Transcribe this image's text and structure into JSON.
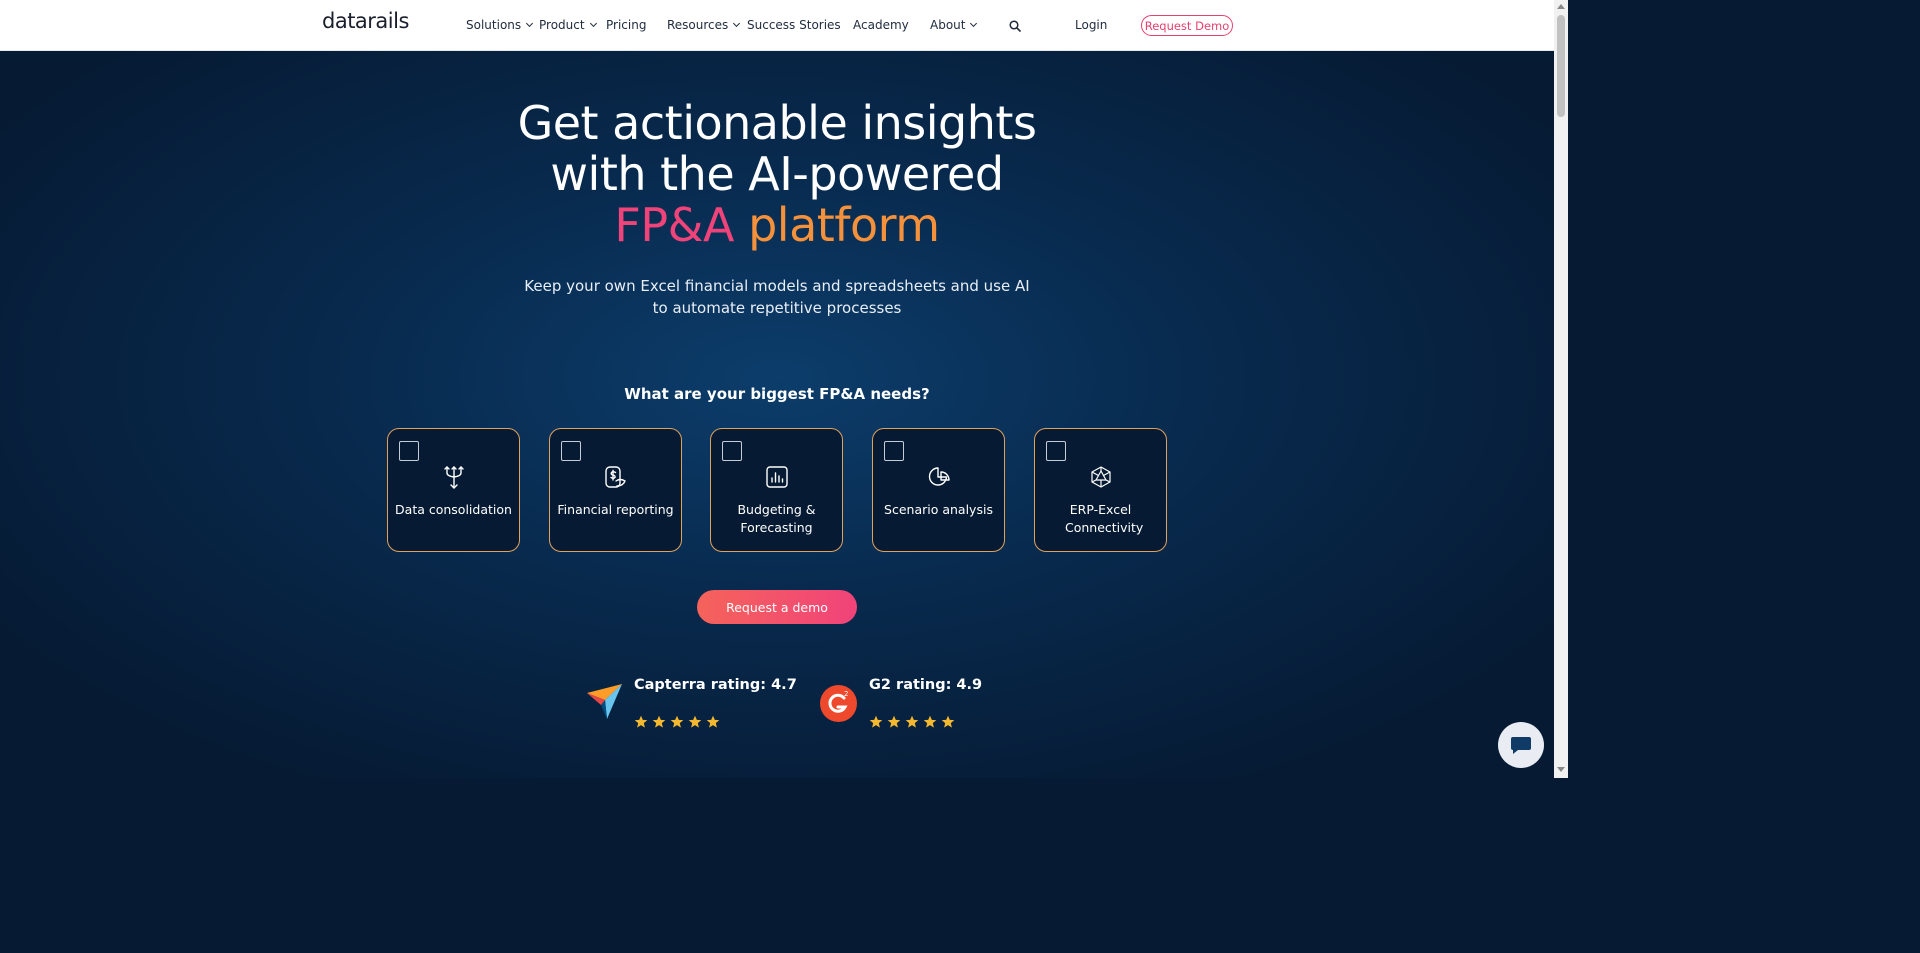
{
  "header": {
    "logo": "datarails",
    "nav": [
      {
        "label": "Solutions",
        "dropdown": true
      },
      {
        "label": "Product",
        "dropdown": true
      },
      {
        "label": "Pricing",
        "dropdown": false
      },
      {
        "label": "Resources",
        "dropdown": true
      },
      {
        "label": "Success Stories",
        "dropdown": false
      },
      {
        "label": "Academy",
        "dropdown": false
      },
      {
        "label": "About",
        "dropdown": true
      }
    ],
    "search_icon": "search-icon",
    "login": "Login",
    "request_demo": "Request Demo"
  },
  "hero": {
    "title_line1": "Get actionable insights",
    "title_line2": "with the AI-powered",
    "title_line3a": "FP&A",
    "title_line3b": "platform",
    "subtitle_line1": "Keep your own Excel financial models and spreadsheets and use AI",
    "subtitle_line2": "to automate repetitive processes",
    "question": "What are your biggest FP&A needs?",
    "cards": [
      {
        "label": "Data consolidation",
        "icon": "merge-arrows-icon",
        "checked": false
      },
      {
        "label": "Financial reporting",
        "icon": "dollar-report-icon",
        "checked": false
      },
      {
        "label": "Budgeting & Forecasting",
        "icon": "bar-chart-icon",
        "checked": false
      },
      {
        "label": "Scenario analysis",
        "icon": "pie-chart-icon",
        "checked": false
      },
      {
        "label": "ERP-Excel Connectivity",
        "icon": "network-icon",
        "checked": false
      }
    ],
    "cta": "Request a demo",
    "ratings": [
      {
        "label": "Capterra rating: 4.7",
        "logo": "capterra-logo",
        "stars": 5
      },
      {
        "label": "G2 rating: 4.9",
        "logo": "g2-logo",
        "stars": 5
      }
    ]
  },
  "colors": {
    "brand_pink": "#f0437a",
    "brand_orange": "#f5913a",
    "hero_bg": "#061a33",
    "card_border": "#e0a25a",
    "star": "#f5b82e"
  },
  "chat_widget": "chat-icon"
}
